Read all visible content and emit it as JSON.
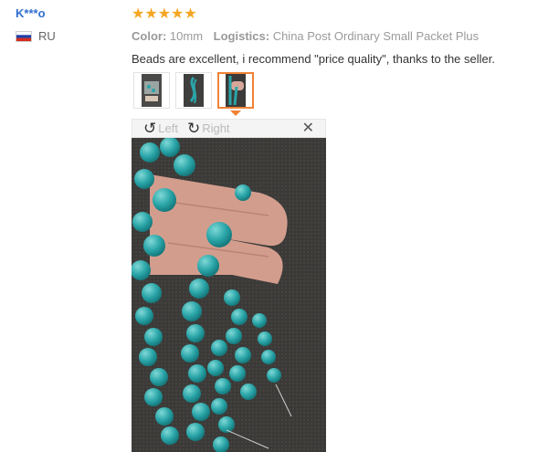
{
  "buyer": {
    "name": "K***o",
    "country_code": "RU",
    "flag_colors": [
      "#ffffff",
      "#1c3fa8",
      "#d52b1e"
    ]
  },
  "review": {
    "rating": 5,
    "stars_text": "★★★★★",
    "color_label": "Color:",
    "color_value": "10mm",
    "logistics_label": "Logistics:",
    "logistics_value": "China Post Ordinary Small Packet Plus",
    "text": "Beads are excellent, i recommend \"price quality\", thanks to the seller."
  },
  "thumbnails": [
    {
      "icon": "photo-thumbnail-1",
      "active": false
    },
    {
      "icon": "photo-thumbnail-2",
      "active": false
    },
    {
      "icon": "photo-thumbnail-3",
      "active": true
    }
  ],
  "viewer": {
    "rotate_left_label": "Left",
    "rotate_right_label": "Right",
    "close_glyph": "✕",
    "rotate_left_glyph": "↺",
    "rotate_right_glyph": "↻"
  },
  "colors": {
    "accent": "#f08236",
    "star": "#f5a623",
    "name_link": "#2f6fd0",
    "bead": "#2aa5a8"
  }
}
